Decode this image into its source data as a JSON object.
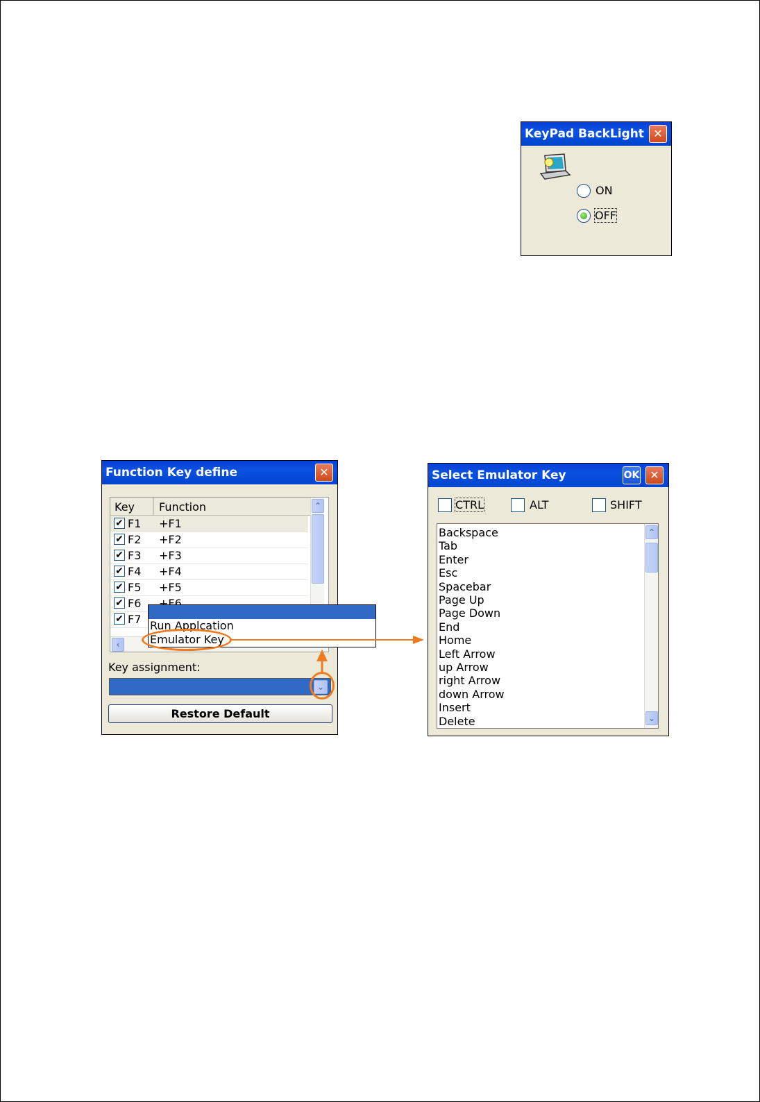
{
  "backlight_dialog": {
    "title": "KeyPad BackLight",
    "close_glyph": "✕",
    "option_on": "ON",
    "option_off": "OFF",
    "selected": "OFF"
  },
  "function_key_dialog": {
    "title": "Function Key define",
    "close_glyph": "✕",
    "col_key": "Key",
    "col_function": "Function",
    "rows": [
      {
        "key": "F1",
        "function": "+F1",
        "checked": true
      },
      {
        "key": "F2",
        "function": "+F2",
        "checked": true
      },
      {
        "key": "F3",
        "function": "+F3",
        "checked": true
      },
      {
        "key": "F4",
        "function": "+F4",
        "checked": true
      },
      {
        "key": "F5",
        "function": "+F5",
        "checked": true
      },
      {
        "key": "F6",
        "function": "+F6",
        "checked": true
      },
      {
        "key": "F7",
        "function": "",
        "checked": true
      }
    ],
    "check_glyph": "✔",
    "dropdown_options": [
      "",
      "Run Application",
      "Emulator Key"
    ],
    "dropdown_option_1_text": "Run Applcation",
    "dropdown_option_2_text": "Emulator Key",
    "key_assignment_label": "Key assignment:",
    "restore_default_label": "Restore Default",
    "scroll_up_glyph": "⌃",
    "scroll_left_glyph": "‹",
    "dropdown_arrow_glyph": "⌄"
  },
  "emulator_dialog": {
    "title": "Select Emulator Key",
    "ok_label": "OK",
    "close_glyph": "✕",
    "modifier_ctrl": "CTRL",
    "modifier_alt": "ALT",
    "modifier_shift": "SHIFT",
    "keys": [
      "Backspace",
      "Tab",
      "Enter",
      "Esc",
      "Spacebar",
      "Page Up",
      "Page Down",
      "End",
      "Home",
      "Left Arrow",
      "up Arrow",
      "right Arrow",
      "down Arrow",
      "Insert",
      "Delete"
    ],
    "scroll_up_glyph": "⌃",
    "scroll_down_glyph": "⌄"
  },
  "annotation": {
    "color": "#f07b1f"
  }
}
